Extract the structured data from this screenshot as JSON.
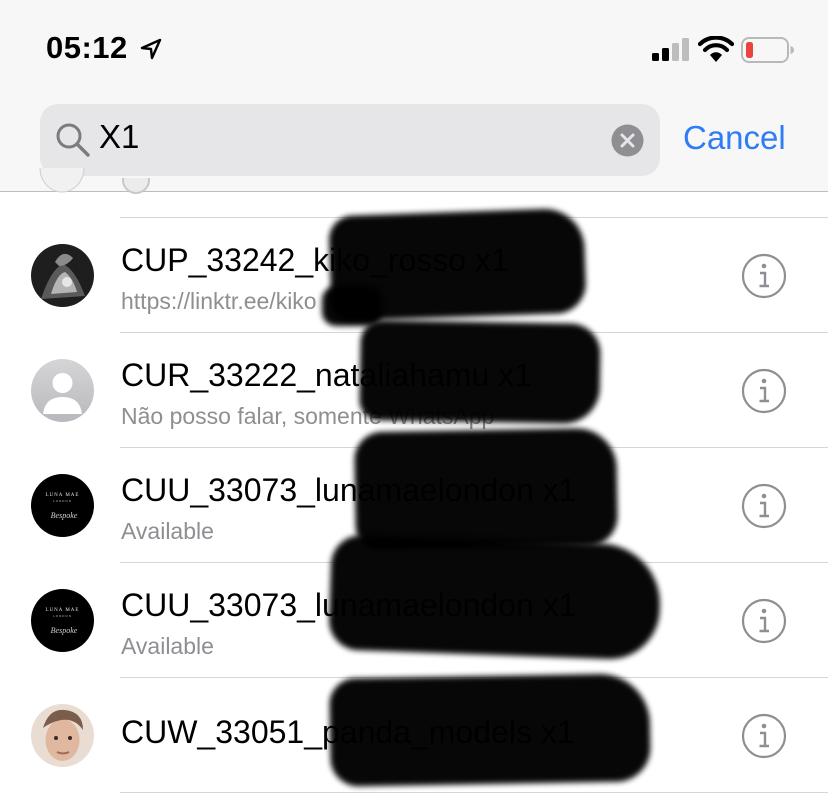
{
  "status_bar": {
    "time": "05:12",
    "icons": [
      "location-arrow-icon",
      "cellular-signal-icon",
      "wifi-icon",
      "battery-low-icon"
    ]
  },
  "search": {
    "query": "X1",
    "cancel_label": "Cancel"
  },
  "contacts": [
    {
      "name": "CUP_33242_kiko_rosso x1",
      "subtitle": "https://linktr.ee/kiko",
      "avatar": "photo-dark"
    },
    {
      "name": "CUR_33222_nataliahamu x1",
      "subtitle": "Não posso falar, somente WhatsApp",
      "avatar": "placeholder"
    },
    {
      "name": "CUU_33073_lunamaelondon x1",
      "subtitle": "Available",
      "avatar": "luna-mae-logo"
    },
    {
      "name": "CUU_33073_lunamaelondon x1",
      "subtitle": "Available",
      "avatar": "luna-mae-logo"
    },
    {
      "name": "CUW_33051_panda_models x1",
      "subtitle": "",
      "avatar": "photo-face"
    }
  ],
  "logo_text": {
    "brand": "LUNA MAE",
    "sub": "LONDON",
    "script": "Bespoke"
  },
  "colors": {
    "accent": "#2f7cf6",
    "battery_low": "#e8453c",
    "secondary_text": "#8e8e93"
  }
}
